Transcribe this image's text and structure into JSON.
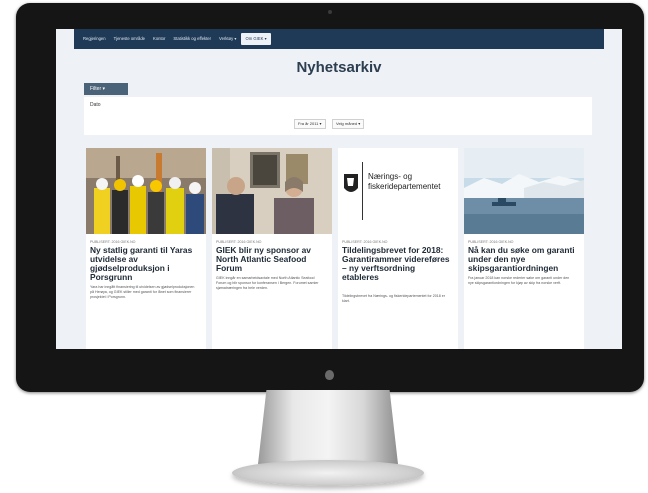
{
  "nav": {
    "items": [
      "Regjeringen",
      "Tjeneste område",
      "Kontor",
      "Statistikk og effekter",
      "Verktøy ▾",
      "Om GIEK ▾"
    ]
  },
  "page": {
    "title": "Nyhetsarkiv"
  },
  "filter": {
    "button_label": "Filter ▾",
    "dato_label": "Dato",
    "from_value": "Fra år 2011 ▾",
    "to_value": "Velg måned ▾"
  },
  "articles": [
    {
      "date": "PUBLISERT: 2016 GIEK.NO",
      "title": "Ny statlig garanti til Yaras utvidelse av gjødselproduksjon i Porsgrunn",
      "excerpt": "Yara har inngått finansiering til utvidelsen av gjødselproduksjonen på Herøya, og GIEK stiller med garanti for lånet som finansierer prosjektet i Porsgrunn.",
      "image": "workers-photo"
    },
    {
      "date": "PUBLISERT: 2016 GIEK.NO",
      "title": "GIEK blir ny sponsor av North Atlantic Seafood Forum",
      "excerpt": "GIEK inngår en samarbeidsavtale med North Atlantic Seafood Forum og blir sponsor for konferansen i Bergen. Forumet samler sjømatnæringen fra hele verden.",
      "image": "meeting-photo"
    },
    {
      "date": "PUBLISERT: 2016 GIEK.NO",
      "title": "Tildelingsbrevet for 2018: Garantirammer videreføres – ny verftsordning etableres",
      "excerpt": "Tildelingsbrevet fra Nærings- og fiskeridepartementet for 2018 er klart.",
      "image": "ministry-logo",
      "logo_text": "Nærings- og fiskeridepartementet"
    },
    {
      "date": "PUBLISERT: 2016 GIEK.NO",
      "title": "Nå kan du søke om garanti under den nye skipsgarantiordningen",
      "excerpt": "Fra januar 2018 kan norske rederier søke om garanti under den nye skipsgarantiordningen for kjøp av skip fra norske verft.",
      "image": "ship-photo"
    }
  ]
}
